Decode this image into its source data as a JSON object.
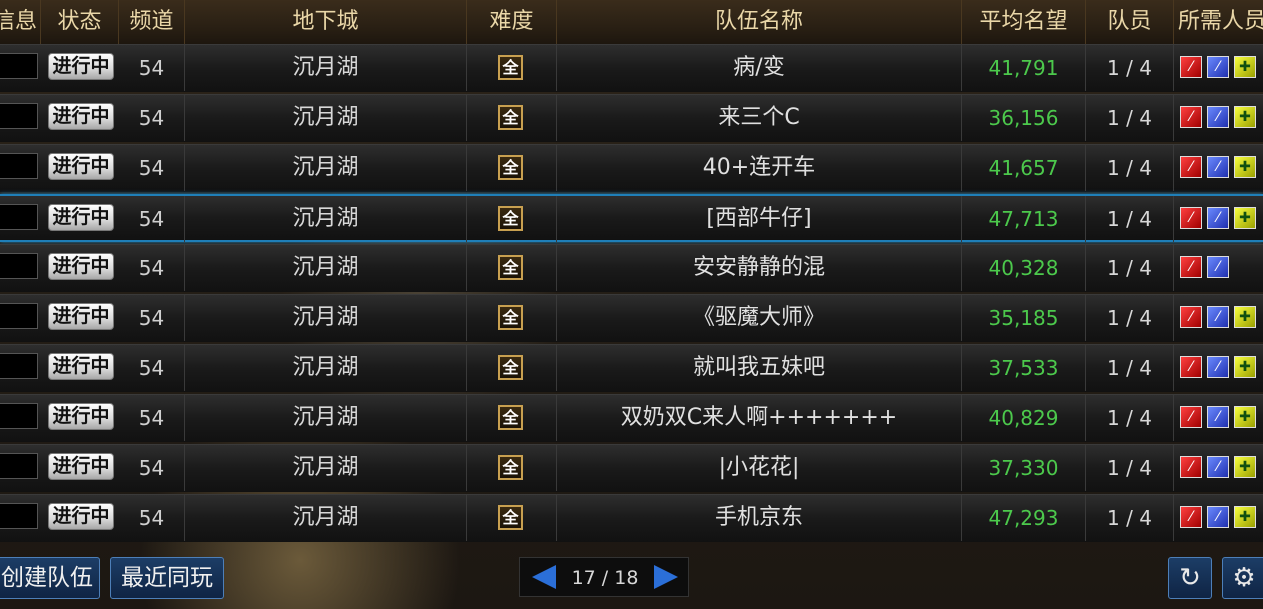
{
  "header": {
    "columns": [
      "信息",
      "状态",
      "频道",
      "地下城",
      "难度",
      "队伍名称",
      "平均名望",
      "队员",
      "所需人员"
    ]
  },
  "rows": [
    {
      "status": "进行中",
      "channel": "54",
      "dungeon": "沉月湖",
      "difficulty": "全",
      "team": "病/变",
      "fame": "41,791",
      "members": "1 / 4",
      "roles": [
        "red",
        "blue",
        "yellow"
      ],
      "selected": false
    },
    {
      "status": "进行中",
      "channel": "54",
      "dungeon": "沉月湖",
      "difficulty": "全",
      "team": "来三个C",
      "fame": "36,156",
      "members": "1 / 4",
      "roles": [
        "red",
        "blue",
        "yellow"
      ],
      "selected": false
    },
    {
      "status": "进行中",
      "channel": "54",
      "dungeon": "沉月湖",
      "difficulty": "全",
      "team": "40+连开车",
      "fame": "41,657",
      "members": "1 / 4",
      "roles": [
        "red",
        "blue",
        "yellow"
      ],
      "selected": false
    },
    {
      "status": "进行中",
      "channel": "54",
      "dungeon": "沉月湖",
      "difficulty": "全",
      "team": "[西部牛仔]",
      "fame": "47,713",
      "members": "1 / 4",
      "roles": [
        "red",
        "blue",
        "yellow"
      ],
      "selected": true
    },
    {
      "status": "进行中",
      "channel": "54",
      "dungeon": "沉月湖",
      "difficulty": "全",
      "team": "安安静静的混",
      "fame": "40,328",
      "members": "1 / 4",
      "roles": [
        "red",
        "blue"
      ],
      "selected": false
    },
    {
      "status": "进行中",
      "channel": "54",
      "dungeon": "沉月湖",
      "difficulty": "全",
      "team": "《驱魔大师》",
      "fame": "35,185",
      "members": "1 / 4",
      "roles": [
        "red",
        "blue",
        "yellow"
      ],
      "selected": false
    },
    {
      "status": "进行中",
      "channel": "54",
      "dungeon": "沉月湖",
      "difficulty": "全",
      "team": "就叫我五妹吧",
      "fame": "37,533",
      "members": "1 / 4",
      "roles": [
        "red",
        "blue",
        "yellow"
      ],
      "selected": false
    },
    {
      "status": "进行中",
      "channel": "54",
      "dungeon": "沉月湖",
      "difficulty": "全",
      "team": "双奶双C来人啊+++++++",
      "fame": "40,829",
      "members": "1 / 4",
      "roles": [
        "red",
        "blue",
        "yellow"
      ],
      "selected": false
    },
    {
      "status": "进行中",
      "channel": "54",
      "dungeon": "沉月湖",
      "difficulty": "全",
      "team": "|小花花|",
      "fame": "37,330",
      "members": "1 / 4",
      "roles": [
        "red",
        "blue",
        "yellow"
      ],
      "selected": false
    },
    {
      "status": "进行中",
      "channel": "54",
      "dungeon": "沉月湖",
      "difficulty": "全",
      "team": "手机京东",
      "fame": "47,293",
      "members": "1 / 4",
      "roles": [
        "red",
        "blue",
        "yellow"
      ],
      "selected": false
    }
  ],
  "footer": {
    "create_team": "创建队伍",
    "recent_players": "最近同玩",
    "page_current": "17",
    "page_total": "18",
    "page_text": "17 / 18"
  },
  "colors": {
    "accent_blue": "#1f7fb8",
    "fame_green": "#4cc94c",
    "role_red": "#d00000",
    "role_blue": "#3050d0",
    "role_yellow": "#d8e000"
  }
}
